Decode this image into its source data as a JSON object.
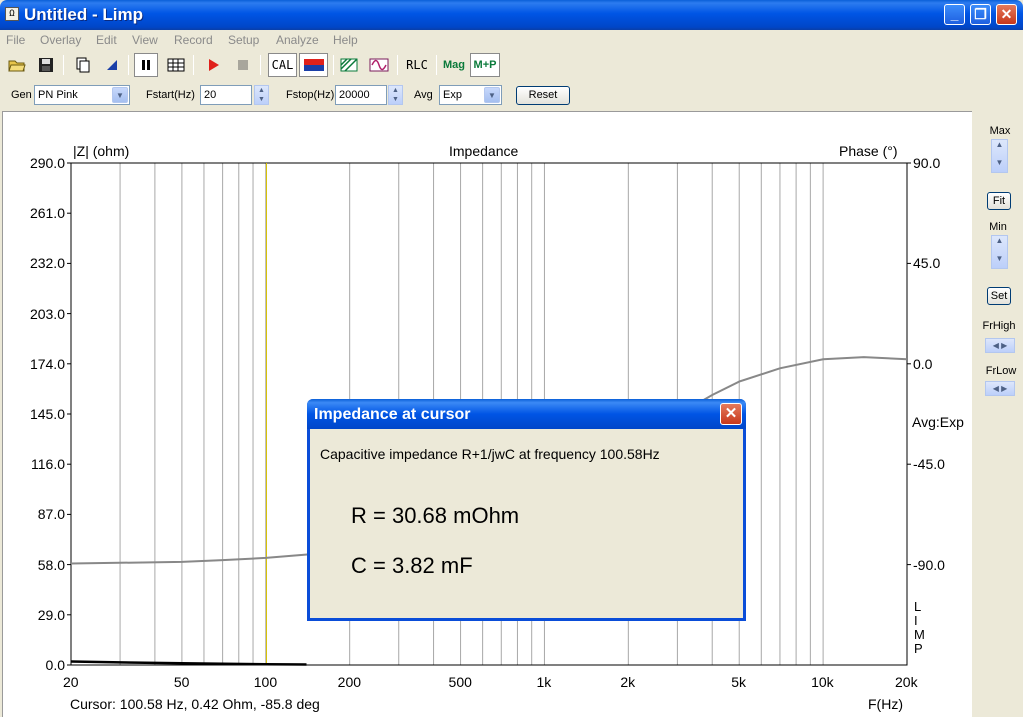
{
  "window": {
    "title": "Untitled - Limp",
    "app_icon": "Ω"
  },
  "menu": [
    "File",
    "Overlay",
    "Edit",
    "View",
    "Record",
    "Setup",
    "Analyze",
    "Help"
  ],
  "toolbar": {
    "cal_label": "CAL",
    "rlc_label": "RLC",
    "mag_label": "Mag",
    "mp_label": "M+P"
  },
  "params": {
    "gen_label": "Gen",
    "gen_value": "PN Pink",
    "fstart_label": "Fstart(Hz)",
    "fstart_value": "20",
    "fstop_label": "Fstop(Hz)",
    "fstop_value": "20000",
    "avg_label": "Avg",
    "avg_value": "Exp",
    "reset_label": "Reset"
  },
  "graph": {
    "title": "Impedance",
    "y1_title": "|Z| (ohm)",
    "y2_title": "Phase (°)",
    "x_title": "F(Hz)",
    "y1_ticks": [
      "290.0",
      "261.0",
      "232.0",
      "203.0",
      "174.0",
      "145.0",
      "116.0",
      "87.0",
      "58.0",
      "29.0",
      "0.0"
    ],
    "y2_ticks": [
      "90.0",
      "45.0",
      "0.0",
      "-45.0",
      "-90.0"
    ],
    "x_ticks": [
      "20",
      "50",
      "100",
      "200",
      "500",
      "1k",
      "2k",
      "5k",
      "10k",
      "20k"
    ],
    "avg_note": "Avg:Exp",
    "limp_letters": [
      "L",
      "I",
      "M",
      "P"
    ],
    "cursor_readout": "Cursor: 100.58 Hz, 0.42 Ohm, -85.8 deg"
  },
  "right_panel": {
    "max_label": "Max",
    "fit_label": "Fit",
    "min_label": "Min",
    "set_label": "Set",
    "frhigh_label": "FrHigh",
    "frlow_label": "FrLow"
  },
  "dialog": {
    "title": "Impedance at cursor",
    "description": "Capacitive impedance R+1/jwC at frequency 100.58Hz",
    "r_line": "R = 30.68 mOhm",
    "c_line": "C = 3.82 mF"
  },
  "chart_data": {
    "type": "line",
    "title": "Impedance",
    "xlabel": "F(Hz)",
    "ylabel": "|Z| (ohm)",
    "y2label": "Phase (°)",
    "x_scale": "log",
    "xlim": [
      20,
      20000
    ],
    "ylim": [
      0,
      290
    ],
    "y2lim": [
      -135,
      90
    ],
    "cursor_x": 100.58,
    "grid": true,
    "series": [
      {
        "axis": "y2",
        "color": "#888888",
        "x": [
          20,
          30,
          50,
          70,
          100,
          150,
          200,
          300,
          500,
          700,
          1000,
          1500,
          2000,
          3000,
          4000,
          5000,
          7000,
          10000,
          14000,
          20000
        ],
        "values": [
          -89.5,
          -89.2,
          -88.8,
          -88.0,
          -87.0,
          -85.2,
          -83.5,
          -80.0,
          -73.0,
          -66.5,
          -58.0,
          -46.0,
          -37.0,
          -23.0,
          -14.0,
          -8.0,
          -2.0,
          2.0,
          3.0,
          2.0
        ]
      },
      {
        "axis": "y1",
        "color": "#000000",
        "x": [
          20,
          30,
          50,
          70,
          100,
          120,
          140
        ],
        "values": [
          2.0,
          1.5,
          1.0,
          0.7,
          0.42,
          0.35,
          0.3
        ]
      }
    ]
  }
}
